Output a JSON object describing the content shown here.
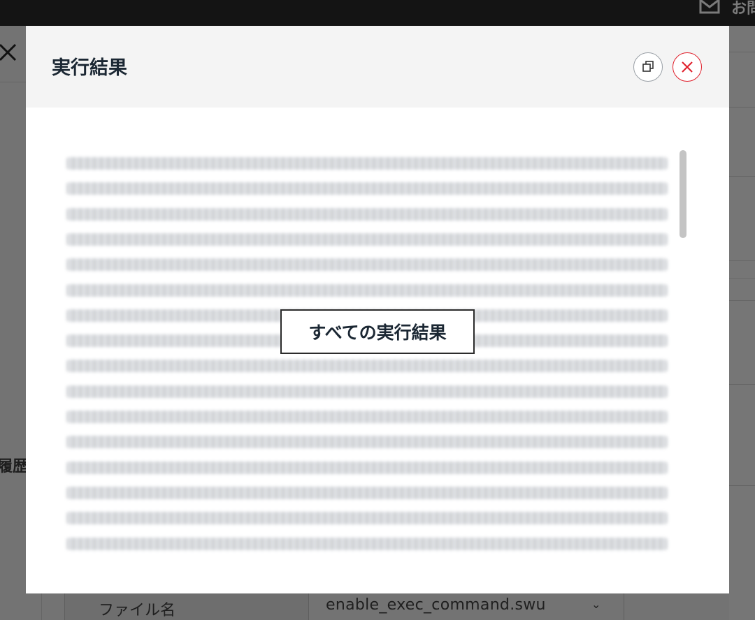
{
  "background": {
    "header_link": "お問",
    "history_label": "履歴",
    "file_label": "ファイル名",
    "file_value": "enable_exec_command.swu",
    "chevron": "⌄"
  },
  "modal": {
    "title": "実行結果",
    "show_all_button": "すべての実行結果",
    "result_lines": 16,
    "colors": {
      "close_accent": "#e01e2a",
      "title_text": "#1b2733",
      "header_bg": "#f4f4f4"
    }
  }
}
